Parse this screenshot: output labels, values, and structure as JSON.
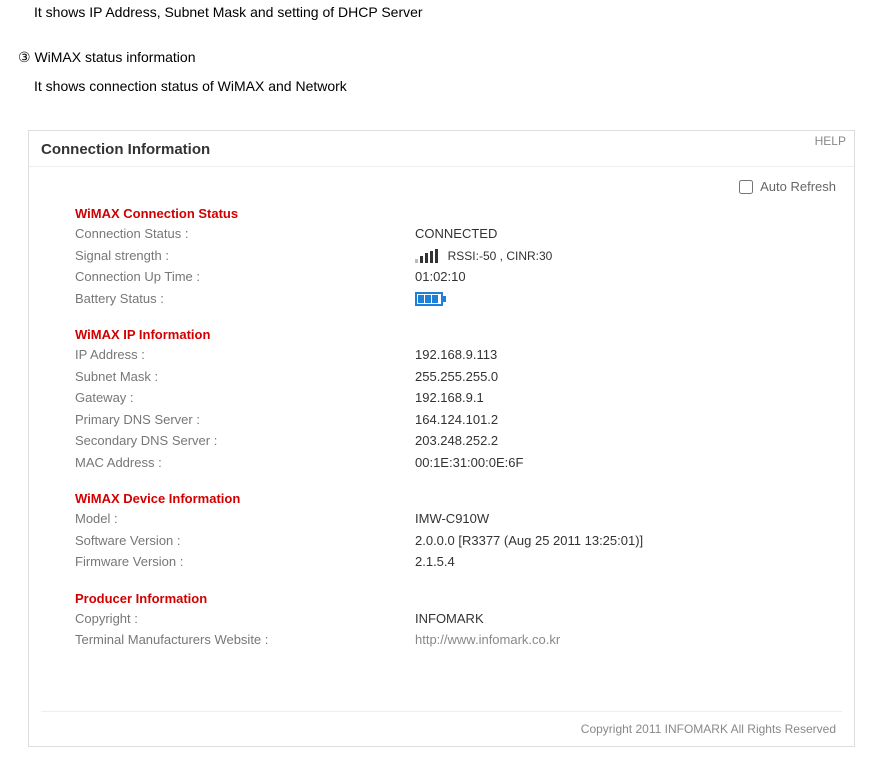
{
  "doc": {
    "line1": "It shows IP Address, Subnet Mask and setting of DHCP Server",
    "numbered": "③ WiMAX status information",
    "line2": "It shows connection status of WiMAX and Network"
  },
  "panel": {
    "help": "HELP",
    "title": "Connection Information",
    "auto_refresh_label": "Auto Refresh",
    "copyright": "Copyright 2011 INFOMARK All Rights Reserved"
  },
  "sections": {
    "conn_status": {
      "heading": "WiMAX Connection Status",
      "rows": {
        "status_label": "Connection Status :",
        "status_value": "CONNECTED",
        "signal_label": "Signal strength :",
        "signal_text": "RSSI:-50 , CINR:30",
        "uptime_label": "Connection Up Time :",
        "uptime_value": "01:02:10",
        "battery_label": "Battery Status :"
      }
    },
    "ip_info": {
      "heading": "WiMAX IP Information",
      "rows": {
        "ip_label": "IP Address :",
        "ip_value": "192.168.9.113",
        "subnet_label": "Subnet Mask :",
        "subnet_value": "255.255.255.0",
        "gateway_label": "Gateway :",
        "gateway_value": "192.168.9.1",
        "pdns_label": "Primary DNS Server :",
        "pdns_value": "164.124.101.2",
        "sdns_label": "Secondary DNS Server :",
        "sdns_value": "203.248.252.2",
        "mac_label": "MAC Address :",
        "mac_value": "00:1E:31:00:0E:6F"
      }
    },
    "device_info": {
      "heading": "WiMAX Device Information",
      "rows": {
        "model_label": "Model :",
        "model_value": "IMW-C910W",
        "sw_label": "Software Version :",
        "sw_value": "2.0.0.0 [R3377 (Aug 25 2011 13:25:01)]",
        "fw_label": "Firmware Version :",
        "fw_value": "2.1.5.4"
      }
    },
    "producer_info": {
      "heading": "Producer Information",
      "rows": {
        "copyright_label": "Copyright :",
        "copyright_value": "INFOMARK",
        "site_label": "Terminal Manufacturers Website :",
        "site_value": "http://www.infomark.co.kr"
      }
    }
  }
}
